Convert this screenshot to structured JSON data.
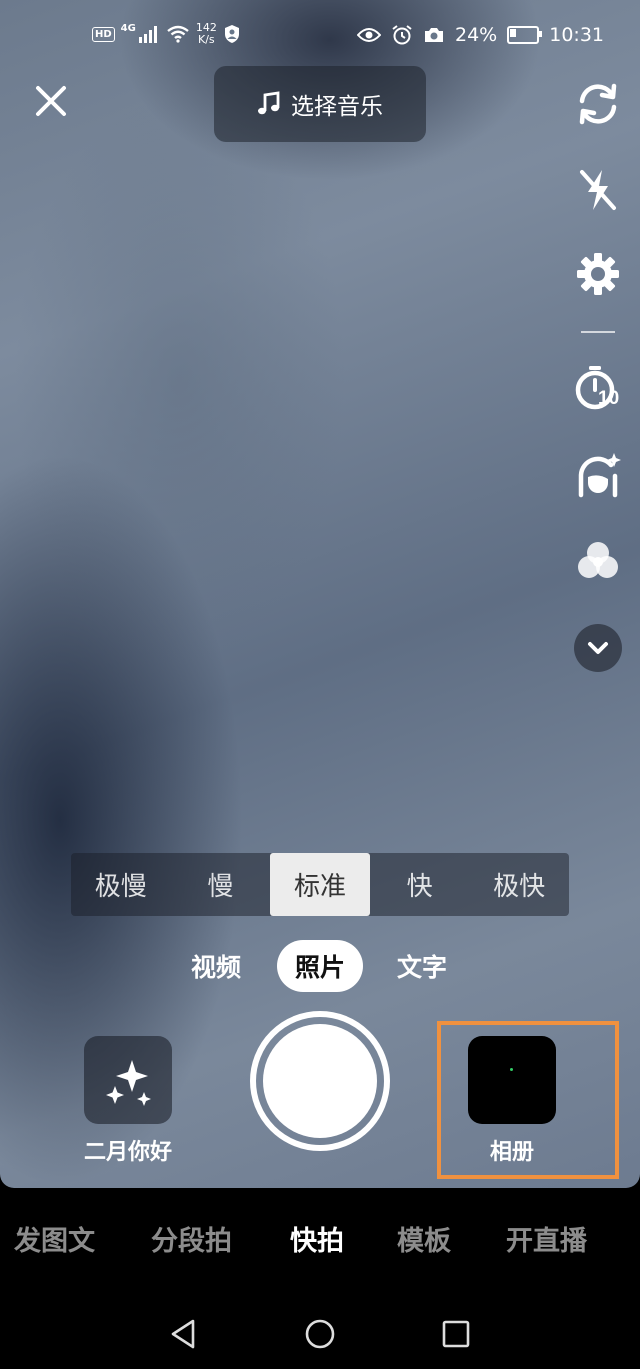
{
  "status_bar": {
    "hd": "HD",
    "network": "4G",
    "speed_value": "142",
    "speed_unit": "K/s",
    "battery": "24%",
    "battery_level": 0.24,
    "time": "10:31"
  },
  "top_bar": {
    "music_label": "选择音乐"
  },
  "side_tools": {
    "timer_badge": "10",
    "icons": [
      "flip-camera-icon",
      "flash-off-icon",
      "settings-icon",
      "timer-icon",
      "beauty-icon",
      "filter-icon",
      "expand-more-icon"
    ]
  },
  "speed": {
    "options": [
      "极慢",
      "慢",
      "标准",
      "快",
      "极快"
    ],
    "selected": "标准"
  },
  "capture_modes": {
    "options": [
      "视频",
      "照片",
      "文字"
    ],
    "selected": "照片"
  },
  "effects": {
    "label": "二月你好"
  },
  "album": {
    "label": "相册",
    "highlight_color": "#f0913f"
  },
  "bottom_tabs": {
    "options": [
      "发图文",
      "分段拍",
      "快拍",
      "模板",
      "开直播"
    ],
    "selected": "快拍"
  }
}
